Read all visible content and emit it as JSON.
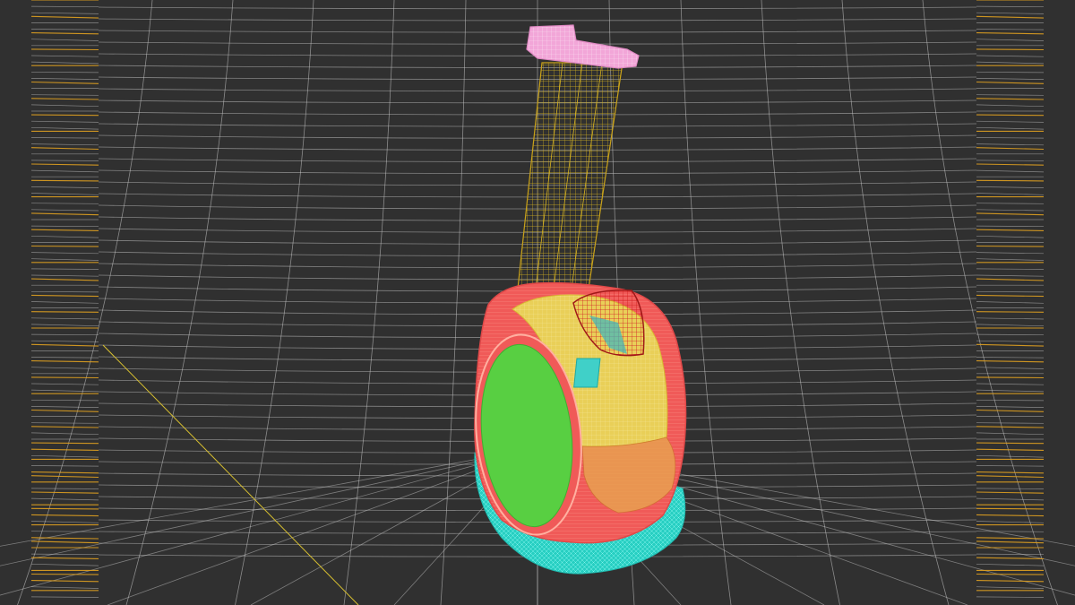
{
  "viewport": {
    "view": "wireframe-3d-viewport",
    "background_color": "#303030",
    "grid_color": "#c8c8c8",
    "side_strip_color": "#e0a020"
  },
  "scene": {
    "object": "self-balancing-scooter",
    "parts": [
      {
        "name": "handlebar-grip",
        "color": "#f4a6d8"
      },
      {
        "name": "steering-column",
        "color": "#c9a21a"
      },
      {
        "name": "control-pod",
        "color": "#a01818"
      },
      {
        "name": "body-shell",
        "color": "#f25a5a"
      },
      {
        "name": "body-top-panel",
        "color": "#e8d25a"
      },
      {
        "name": "wheel-hub-disc",
        "color": "#55d040"
      },
      {
        "name": "base-tire",
        "color": "#2de0d0"
      },
      {
        "name": "indicator-panel",
        "color": "#40d0c8"
      }
    ]
  }
}
